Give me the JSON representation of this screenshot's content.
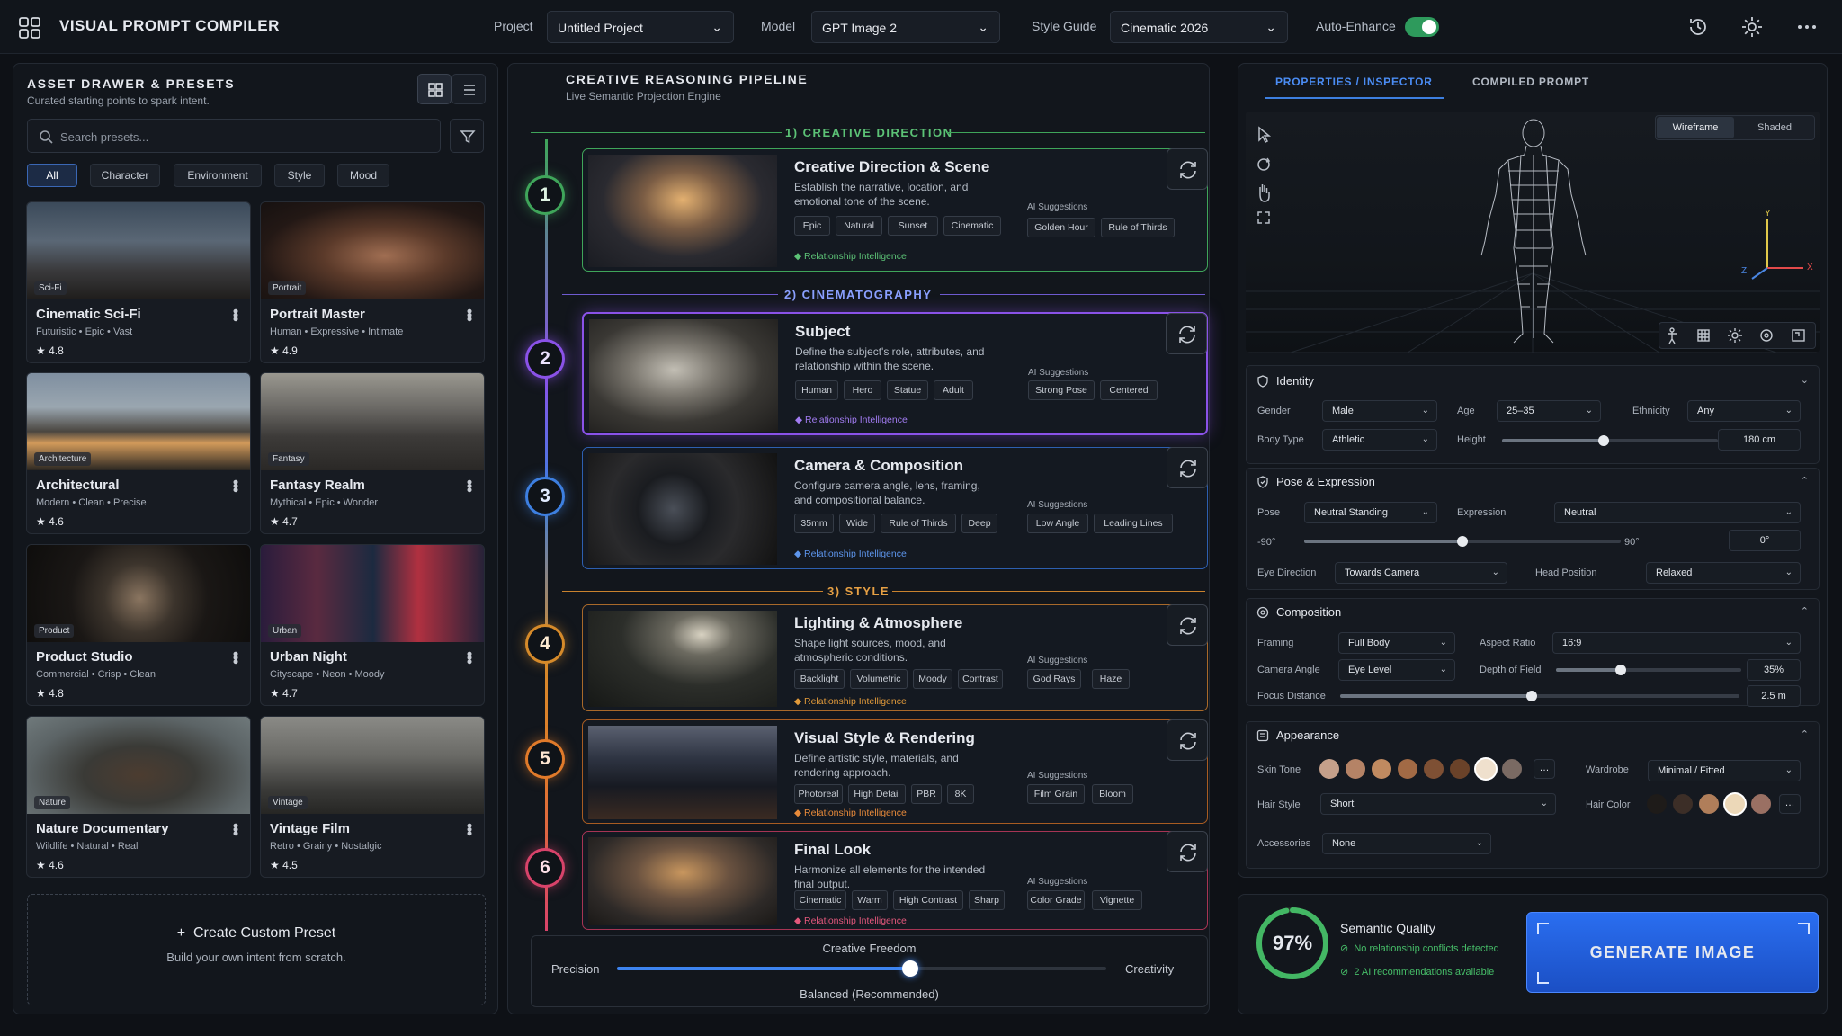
{
  "app": {
    "title": "VISUAL PROMPT COMPILER"
  },
  "topbar": {
    "project_label": "Project",
    "project_value": "Untitled Project",
    "model_label": "Model",
    "model_value": "GPT Image 2",
    "style_label": "Style Guide",
    "style_value": "Cinematic 2026",
    "enhance_label": "Auto-Enhance"
  },
  "drawer": {
    "title": "ASSET DRAWER & PRESETS",
    "subtitle": "Curated starting points to spark intent.",
    "search_placeholder": "Search presets...",
    "chips": [
      "All",
      "Character",
      "Environment",
      "Style",
      "Mood"
    ],
    "cards": [
      {
        "tag": "Sci-Fi",
        "name": "Cinematic Sci-Fi",
        "meta": "Futuristic • Epic • Vast",
        "rating": "★ 4.8"
      },
      {
        "tag": "Portrait",
        "name": "Portrait Master",
        "meta": "Human • Expressive • Intimate",
        "rating": "★ 4.9"
      },
      {
        "tag": "Architecture",
        "name": "Architectural",
        "meta": "Modern • Clean • Precise",
        "rating": "★ 4.6"
      },
      {
        "tag": "Fantasy",
        "name": "Fantasy Realm",
        "meta": "Mythical • Epic • Wonder",
        "rating": "★ 4.7"
      },
      {
        "tag": "Product",
        "name": "Product Studio",
        "meta": "Commercial • Crisp • Clean",
        "rating": "★ 4.8"
      },
      {
        "tag": "Urban",
        "name": "Urban Night",
        "meta": "Cityscape • Neon • Moody",
        "rating": "★ 4.7"
      },
      {
        "tag": "Nature",
        "name": "Nature Documentary",
        "meta": "Wildlife • Natural • Real",
        "rating": "★ 4.6"
      },
      {
        "tag": "Vintage",
        "name": "Vintage Film",
        "meta": "Retro • Grainy • Nostalgic",
        "rating": "★ 4.5"
      }
    ],
    "custom_title": "Create Custom Preset",
    "custom_sub": "Build your own intent from scratch."
  },
  "pipeline": {
    "title": "CREATIVE REASONING PIPELINE",
    "subtitle": "Live Semantic Projection Engine",
    "sections": [
      "1)  CREATIVE DIRECTION",
      "2)  CINEMATOGRAPHY",
      "3)  STYLE"
    ],
    "ai_label": "AI Suggestions",
    "rel_label": "Relationship Intelligence",
    "stages": [
      {
        "num": "1",
        "title": "Creative Direction & Scene",
        "desc": "Establish the narrative, location, and emotional tone of the scene.",
        "tags": [
          "Epic",
          "Natural",
          "Sunset",
          "Cinematic"
        ],
        "ai": [
          "Golden Hour",
          "Rule of Thirds"
        ],
        "color": "#3fa55a"
      },
      {
        "num": "2",
        "title": "Subject",
        "desc": "Define the subject's role, attributes, and relationship within the scene.",
        "tags": [
          "Human",
          "Hero",
          "Statue",
          "Adult"
        ],
        "ai": [
          "Strong Pose",
          "Centered"
        ],
        "color": "#8a52e8"
      },
      {
        "num": "3",
        "title": "Camera & Composition",
        "desc": "Configure camera angle, lens, framing, and compositional balance.",
        "tags": [
          "35mm",
          "Wide",
          "Rule of Thirds",
          "Deep"
        ],
        "ai": [
          "Low Angle",
          "Leading Lines"
        ],
        "color": "#3d7fe0"
      },
      {
        "num": "4",
        "title": "Lighting & Atmosphere",
        "desc": "Shape light sources, mood, and atmospheric conditions.",
        "tags": [
          "Backlight",
          "Volumetric",
          "Moody",
          "Contrast"
        ],
        "ai": [
          "God Rays",
          "Haze"
        ],
        "color": "#d58a2a"
      },
      {
        "num": "5",
        "title": "Visual Style & Rendering",
        "desc": "Define artistic style, materials, and rendering approach.",
        "tags": [
          "Photoreal",
          "High Detail",
          "PBR",
          "8K"
        ],
        "ai": [
          "Film Grain",
          "Bloom"
        ],
        "color": "#e07a2a"
      },
      {
        "num": "6",
        "title": "Final Look",
        "desc": "Harmonize all elements for the intended final output.",
        "tags": [
          "Cinematic",
          "Warm",
          "High Contrast",
          "Sharp"
        ],
        "ai": [
          "Color Grade",
          "Vignette"
        ],
        "color": "#d8436a"
      }
    ],
    "freedom": {
      "title": "Creative Freedom",
      "left": "Precision",
      "right": "Creativity",
      "value_label": "Balanced (Recommended)",
      "value": 0.6
    }
  },
  "inspector": {
    "tabs": [
      "PROPERTIES / INSPECTOR",
      "COMPILED PROMPT"
    ],
    "view_modes": [
      "Wireframe",
      "Shaded"
    ],
    "axes": {
      "x": "X",
      "y": "Y",
      "z": "Z"
    },
    "identity": {
      "title": "Identity",
      "gender_label": "Gender",
      "gender": "Male",
      "age_label": "Age",
      "age": "25–35",
      "ethnicity_label": "Ethnicity",
      "ethnicity": "Any",
      "body_label": "Body Type",
      "body": "Athletic",
      "height_label": "Height",
      "height": "180 cm",
      "height_level": 0.47
    },
    "pose": {
      "title": "Pose & Expression",
      "pose_label": "Pose",
      "pose": "Neutral Standing",
      "expr_label": "Expression",
      "expr": "Neutral",
      "min": "-90°",
      "max": "90°",
      "angle": "0°",
      "angle_level": 0.5,
      "eye_label": "Eye Direction",
      "eye": "Towards Camera",
      "head_label": "Head Position",
      "head": "Relaxed"
    },
    "composition": {
      "title": "Composition",
      "framing_label": "Framing",
      "framing": "Full Body",
      "aspect_label": "Aspect Ratio",
      "aspect": "16:9",
      "angle_label": "Camera Angle",
      "angle": "Eye Level",
      "dof_label": "Depth of Field",
      "dof": "35%",
      "dof_level": 0.35,
      "focus_label": "Focus Distance",
      "focus": "2.5 m",
      "focus_level": 0.48
    },
    "appearance": {
      "title": "Appearance",
      "skin_label": "Skin Tone",
      "skin_tones": [
        "#c5a08a",
        "#b58366",
        "#c08a60",
        "#a26a45",
        "#7e5034",
        "#6a4229",
        "#efe0cd",
        "#7a6a63"
      ],
      "wardrobe_label": "Wardrobe",
      "wardrobe": "Minimal / Fitted",
      "hair_style_label": "Hair Style",
      "hair_style": "Short",
      "hair_color_label": "Hair Color",
      "hair_colors": [
        "#1e1b19",
        "#3c2e27",
        "#b07e5a",
        "#ecd8b8",
        "#9a7063"
      ],
      "accessories_label": "Accessories",
      "accessories": "None"
    }
  },
  "quality": {
    "percent": "97%",
    "value": 0.97,
    "title": "Semantic Quality",
    "line1": "No relationship conflicts detected",
    "line2": "2 AI recommendations available"
  },
  "generate": {
    "label": "GENERATE IMAGE"
  }
}
